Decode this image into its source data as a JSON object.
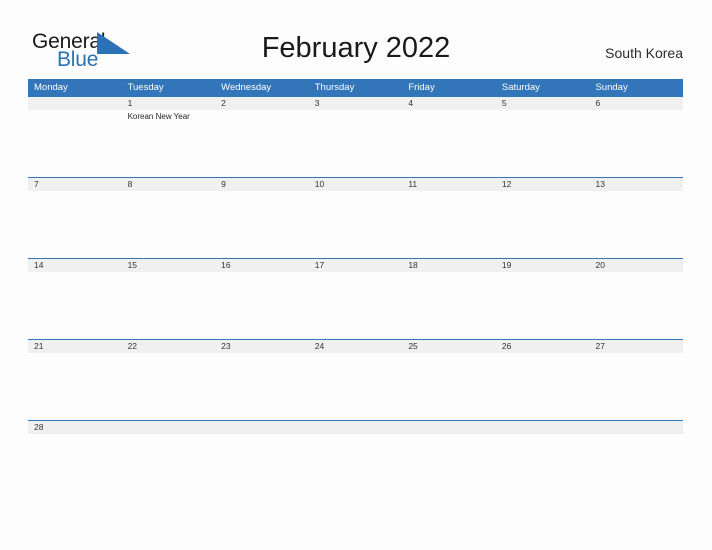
{
  "brand": {
    "name_part1": "General",
    "name_part2": "Blue",
    "triangle_icon": "triangle-icon",
    "accent_color": "#2a72b5"
  },
  "header": {
    "title": "February 2022",
    "country": "South Korea"
  },
  "colors": {
    "header_blue": "#3275b8",
    "date_row_gray": "#f0f0f0",
    "page_background": "#fdfdfd",
    "text_dark": "#1a1a1a"
  },
  "calendar": {
    "month": "February",
    "year": "2022",
    "weekday_headers": [
      "Monday",
      "Tuesday",
      "Wednesday",
      "Thursday",
      "Friday",
      "Saturday",
      "Sunday"
    ],
    "weeks": [
      {
        "days": [
          {
            "date": "",
            "events": []
          },
          {
            "date": "1",
            "events": [
              "Korean New Year"
            ]
          },
          {
            "date": "2",
            "events": []
          },
          {
            "date": "3",
            "events": []
          },
          {
            "date": "4",
            "events": []
          },
          {
            "date": "5",
            "events": []
          },
          {
            "date": "6",
            "events": []
          }
        ]
      },
      {
        "days": [
          {
            "date": "7",
            "events": []
          },
          {
            "date": "8",
            "events": []
          },
          {
            "date": "9",
            "events": []
          },
          {
            "date": "10",
            "events": []
          },
          {
            "date": "11",
            "events": []
          },
          {
            "date": "12",
            "events": []
          },
          {
            "date": "13",
            "events": []
          }
        ]
      },
      {
        "days": [
          {
            "date": "14",
            "events": []
          },
          {
            "date": "15",
            "events": []
          },
          {
            "date": "16",
            "events": []
          },
          {
            "date": "17",
            "events": []
          },
          {
            "date": "18",
            "events": []
          },
          {
            "date": "19",
            "events": []
          },
          {
            "date": "20",
            "events": []
          }
        ]
      },
      {
        "days": [
          {
            "date": "21",
            "events": []
          },
          {
            "date": "22",
            "events": []
          },
          {
            "date": "23",
            "events": []
          },
          {
            "date": "24",
            "events": []
          },
          {
            "date": "25",
            "events": []
          },
          {
            "date": "26",
            "events": []
          },
          {
            "date": "27",
            "events": []
          }
        ]
      },
      {
        "days": [
          {
            "date": "28",
            "events": []
          },
          {
            "date": "",
            "events": []
          },
          {
            "date": "",
            "events": []
          },
          {
            "date": "",
            "events": []
          },
          {
            "date": "",
            "events": []
          },
          {
            "date": "",
            "events": []
          },
          {
            "date": "",
            "events": []
          }
        ]
      }
    ]
  }
}
